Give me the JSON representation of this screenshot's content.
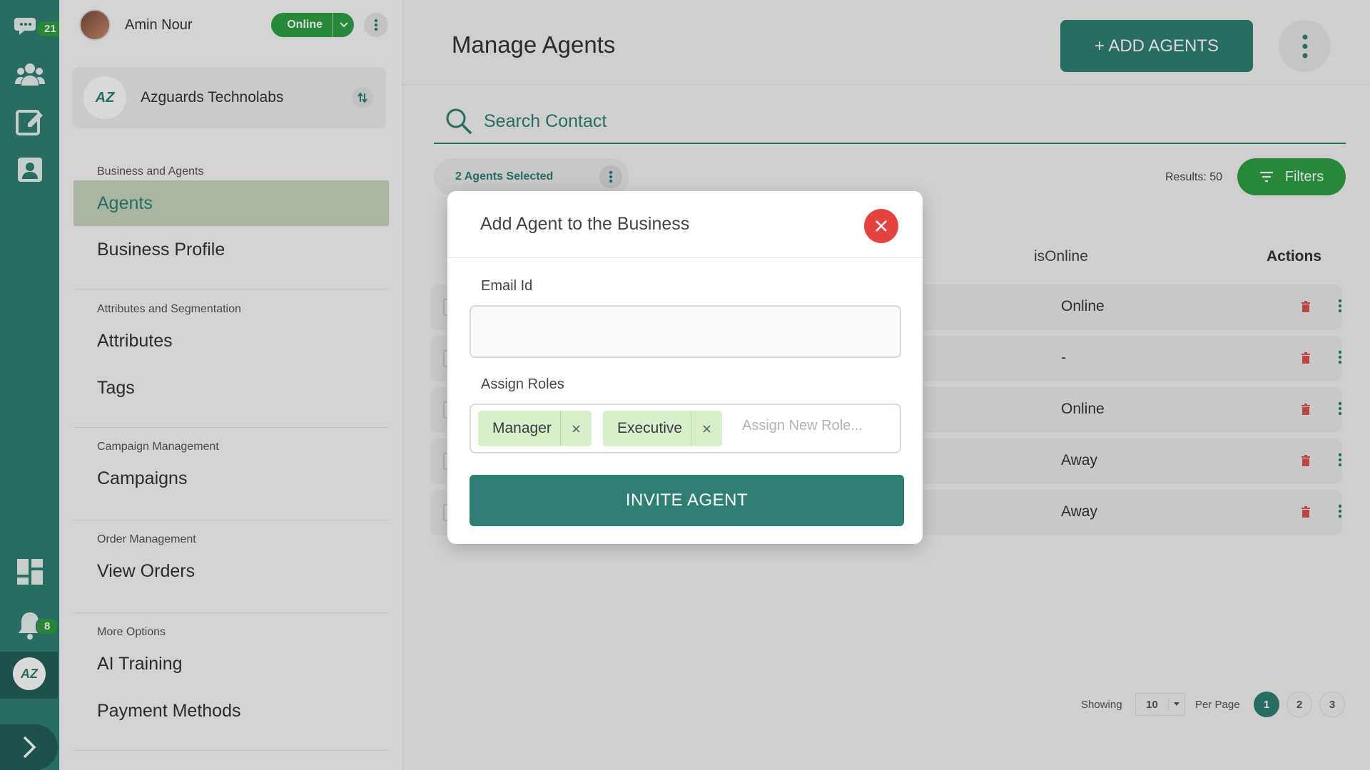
{
  "rail": {
    "chat_badge": "21",
    "notif_badge": "8",
    "workspace_logo": "AZ"
  },
  "user": {
    "name": "Amin Nour",
    "status": "Online"
  },
  "business": {
    "name": "Azguards Technolabs",
    "logo": "AZ"
  },
  "sidebar": {
    "sections": [
      {
        "heading": "Business and Agents",
        "items": [
          "Agents",
          "Business Profile"
        ]
      },
      {
        "heading": "Attributes and Segmentation",
        "items": [
          "Attributes",
          "Tags"
        ]
      },
      {
        "heading": "Campaign Management",
        "items": [
          "Campaigns"
        ]
      },
      {
        "heading": "Order Management",
        "items": [
          "View Orders"
        ]
      },
      {
        "heading": "More Options",
        "items": [
          "AI Training",
          "Payment Methods"
        ]
      }
    ],
    "active_item": "Agents"
  },
  "main": {
    "title": "Manage Agents",
    "add_button": "+ ADD AGENTS",
    "search_placeholder": "Search Contact",
    "selected_label": "2 Agents Selected",
    "results": "Results: 50",
    "filters_label": "Filters",
    "columns": {
      "online": "isOnline",
      "actions": "Actions"
    },
    "rows": [
      {
        "status": "Online"
      },
      {
        "status": "-"
      },
      {
        "status": "Online"
      },
      {
        "status": "Away"
      },
      {
        "status": "Away"
      }
    ],
    "pagination": {
      "showing_label": "Showing",
      "per_page_value": "10",
      "per_page_label": "Per Page",
      "pages": [
        "1",
        "2",
        "3"
      ],
      "current_page": "1"
    }
  },
  "modal": {
    "title": "Add Agent to the Business",
    "email_label": "Email Id",
    "email_value": "",
    "roles_label": "Assign Roles",
    "roles": [
      "Manager",
      "Executive"
    ],
    "role_placeholder": "Assign New Role...",
    "invite_button": "INVITE AGENT"
  },
  "colors": {
    "brand": "#2f7f74",
    "online_green": "#2ea043",
    "danger": "#e54242",
    "role_chip": "#d7efcb"
  }
}
